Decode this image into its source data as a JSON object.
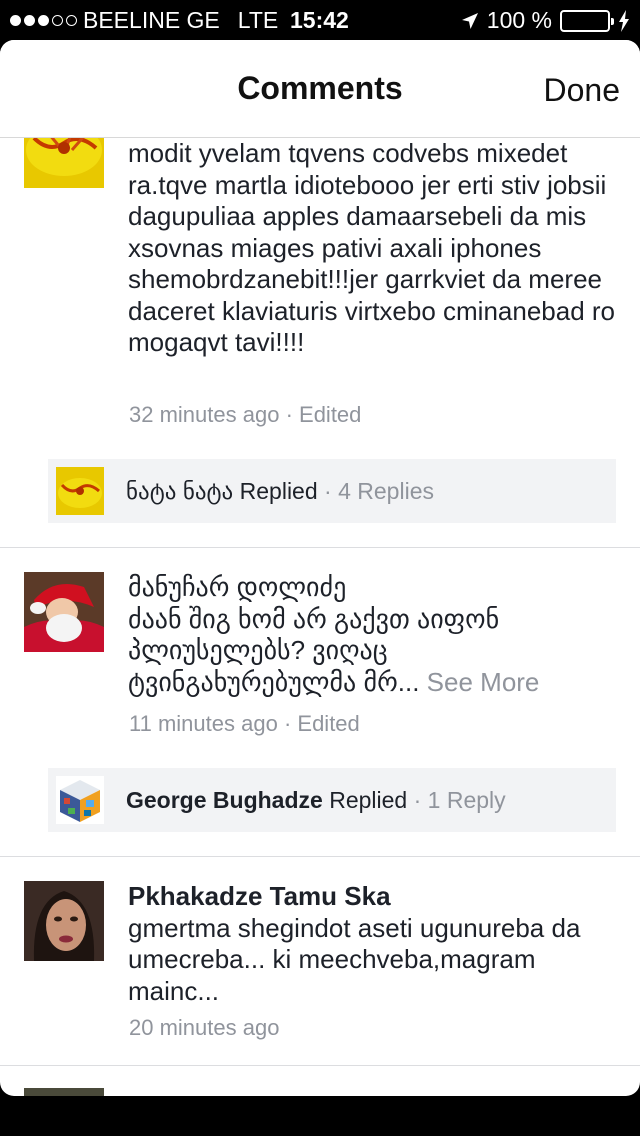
{
  "status_bar": {
    "carrier": "BEELINE GE",
    "network": "LTE",
    "time": "15:42",
    "battery": "100 %",
    "signal_bars_filled": 3,
    "signal_bars_total": 5
  },
  "nav": {
    "title": "Comments",
    "done_label": "Done"
  },
  "comments": [
    {
      "author": "",
      "text": "modit yvelam tqvens codvebs mixedet ra.tqve martla idiotebooo jer erti stiv jobsii dagupuliaa apples damaarsebeli da mis xsovnas miages pativi axali iphones shemobrdzanebit!!!jer garrkviet da meree daceret klaviaturis virtxebo cminanebad ro mogaqvt tavi!!!!",
      "time": "32 minutes ago",
      "edited": "Edited",
      "replies": {
        "name": "ნატა ნატა",
        "action": "Replied",
        "count": "4 Replies"
      }
    },
    {
      "author": "მანუჩარ დოლიძე",
      "text": "ძაან შიგ ხომ არ გაქვთ აიფონ პლიუსელებს? ვიღაც ტვინგახურებულმა მრ...",
      "see_more": "See More",
      "time": "11 minutes ago",
      "edited": "Edited",
      "replies": {
        "name": "George Bughadze",
        "action": "Replied",
        "count": "1 Reply"
      }
    },
    {
      "author": "Pkhakadze Tamu Ska",
      "text": "gmertma shegindot aseti ugunureba da umecreba... ki meechveba,magram mainc...",
      "time": "20 minutes ago"
    }
  ],
  "separator": "·",
  "colors": {
    "text": "#1d2129",
    "meta": "#90949c",
    "reply_bg": "#f2f3f5",
    "battery": "#4cd964"
  }
}
